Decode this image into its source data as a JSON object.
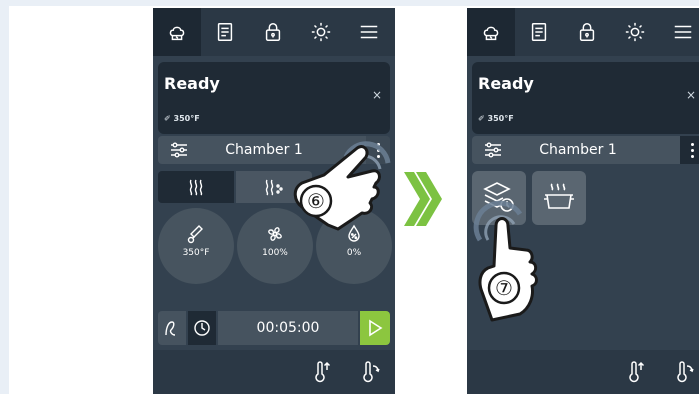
{
  "left_screen": {
    "topbar": {
      "icons": [
        "chef-hat-icon",
        "recipe-book-icon",
        "lock-icon",
        "brightness-icon",
        "menu-icon"
      ]
    },
    "status": {
      "title": "Ready",
      "close": "×",
      "temperature": "350°F"
    },
    "chamber": {
      "label": "Chamber 1"
    },
    "modes": [
      {
        "icon": "heat-icon",
        "label": "≀≀≀"
      },
      {
        "icon": "steam-icon",
        "label": "≀≀⫶"
      }
    ],
    "dials": [
      {
        "icon": "thermometer-icon",
        "value": "350°F"
      },
      {
        "icon": "fan-icon",
        "value": "100%"
      },
      {
        "icon": "humidity-icon",
        "value": "0%"
      }
    ],
    "timer": {
      "value": "00:05:00"
    },
    "footer": {
      "icons": [
        "preheat-icon",
        "cooldown-icon"
      ]
    },
    "step_marker": "⑥"
  },
  "right_screen": {
    "topbar": {
      "icons": [
        "chef-hat-icon",
        "recipe-book-icon",
        "lock-icon",
        "brightness-icon",
        "menu-icon"
      ]
    },
    "status": {
      "title": "Ready",
      "close": "×",
      "temperature": "350°F"
    },
    "chamber": {
      "label": "Chamber 1"
    },
    "options": [
      {
        "icon": "stacked-trays-timer-icon"
      },
      {
        "icon": "steaming-pan-icon"
      }
    ],
    "footer": {
      "icons": [
        "preheat-icon",
        "cooldown-icon"
      ]
    },
    "step_marker": "⑦"
  },
  "colors": {
    "screen_bg": "#33414f",
    "topbar_bg": "#2b3845",
    "accent_green": "#8cc63f",
    "arrow_green": "#7cc242"
  }
}
